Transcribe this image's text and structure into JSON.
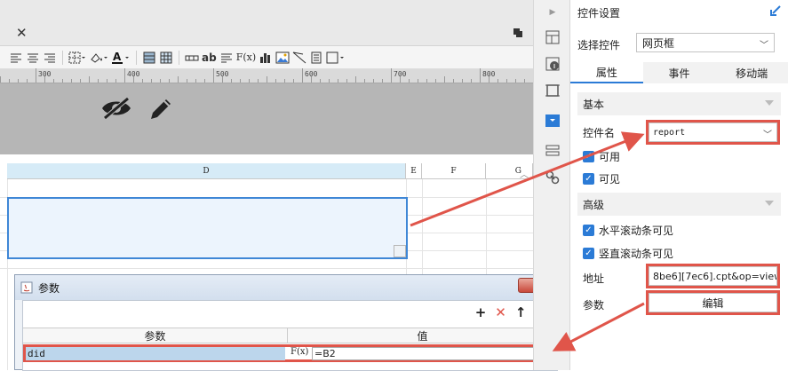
{
  "toolbar": {
    "format_font": "F(x)",
    "abc_label": "ab"
  },
  "ruler": {
    "marks": [
      "300",
      "400",
      "500",
      "600",
      "700",
      "800"
    ]
  },
  "grid": {
    "columns": [
      "D",
      "E",
      "F",
      "G"
    ]
  },
  "dialog": {
    "title": "参数",
    "close_label": "✕",
    "actions": [
      "+",
      "✕",
      "↑",
      "↓"
    ],
    "columns": [
      "参数",
      "值"
    ],
    "rows": [
      {
        "param": "did",
        "formula_icon": "F(x)",
        "value": "=B2"
      }
    ]
  },
  "panel": {
    "title": "控件设置",
    "select_label": "选择控件",
    "select_value": "网页框",
    "tabs": [
      {
        "label": "属性",
        "active": true
      },
      {
        "label": "事件",
        "active": false
      },
      {
        "label": "移动端",
        "active": false
      }
    ],
    "sections": {
      "basic": "基本",
      "advanced": "高级"
    },
    "widget_name_label": "控件名",
    "widget_name_value": "report",
    "enabled_label": "可用",
    "visible_label": "可见",
    "hscroll_label": "水平滚动条可见",
    "vscroll_label": "竖直滚动条可见",
    "address_label": "地址",
    "address_value": "8be6][7ec6].cpt&op=view",
    "params_label": "参数",
    "edit_button": "编辑"
  },
  "colors": {
    "accent": "#2b7bd6",
    "highlight": "#e0554a",
    "selection_fill": "#ecf4fd",
    "column_header": "#d6ebf7"
  }
}
